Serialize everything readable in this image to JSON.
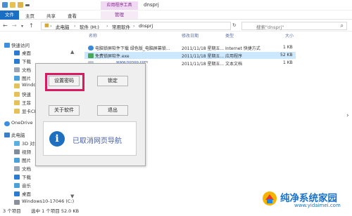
{
  "window": {
    "title": "dnsprj",
    "ribbon_context": "应用程序工具"
  },
  "ribbon": {
    "tabs": [
      "文件",
      "主页",
      "共享",
      "查看",
      "管理"
    ]
  },
  "address": {
    "crumbs": [
      "此电脑",
      "软件 (M:)",
      "常用软件",
      "dnsprj"
    ],
    "search_placeholder": "搜索\"dnsprj\""
  },
  "nav": {
    "items": [
      "快速访问",
      "桌面",
      "下载",
      "文档",
      "图片",
      "Windows 10",
      "快速",
      "王菲",
      "显卡CPU",
      "OneDrive",
      "此电脑",
      "3D 对象",
      "视频",
      "图片",
      "文档",
      "下载",
      "音乐",
      "桌面",
      "Windows10-17046 (C:)"
    ]
  },
  "files": {
    "columns": [
      "名称",
      "修改日期",
      "类型",
      "大小"
    ],
    "rows": [
      {
        "name": "电脑锁屏软件下载 绿色版_电脑屏幕锁...",
        "date": "2011/11/18 星期五...",
        "type": "Internet 快捷方式",
        "size": "1 KB"
      },
      {
        "name": "免费锁屏软件.exe",
        "date": "2011/11/18 星期五...",
        "type": "应用程序",
        "size": "52 KB"
      },
      {
        "name": "",
        "date": "2011/11/18 星期五...",
        "type": "文本文档",
        "size": "1 KB"
      }
    ],
    "overlay_link": "www.nonoo.com"
  },
  "dialog": {
    "set_password": "设置密码",
    "lock_screen": "锁定",
    "about": "关于软件",
    "exit": "退出",
    "notice": "已取消网页导航"
  },
  "status": {
    "count": "3 个项目",
    "selection": "选中 1 个项目  52.0 KB"
  },
  "watermark": {
    "title": "纯净系统家园",
    "url": "www.yidaimei.com"
  },
  "colors": {
    "accent": "#1a6fc4",
    "tools_tab": "#f0d9f2",
    "selection": "#cce8ff",
    "highlight_frame": "#d81b60",
    "info_icon": "#1f6fc0"
  }
}
